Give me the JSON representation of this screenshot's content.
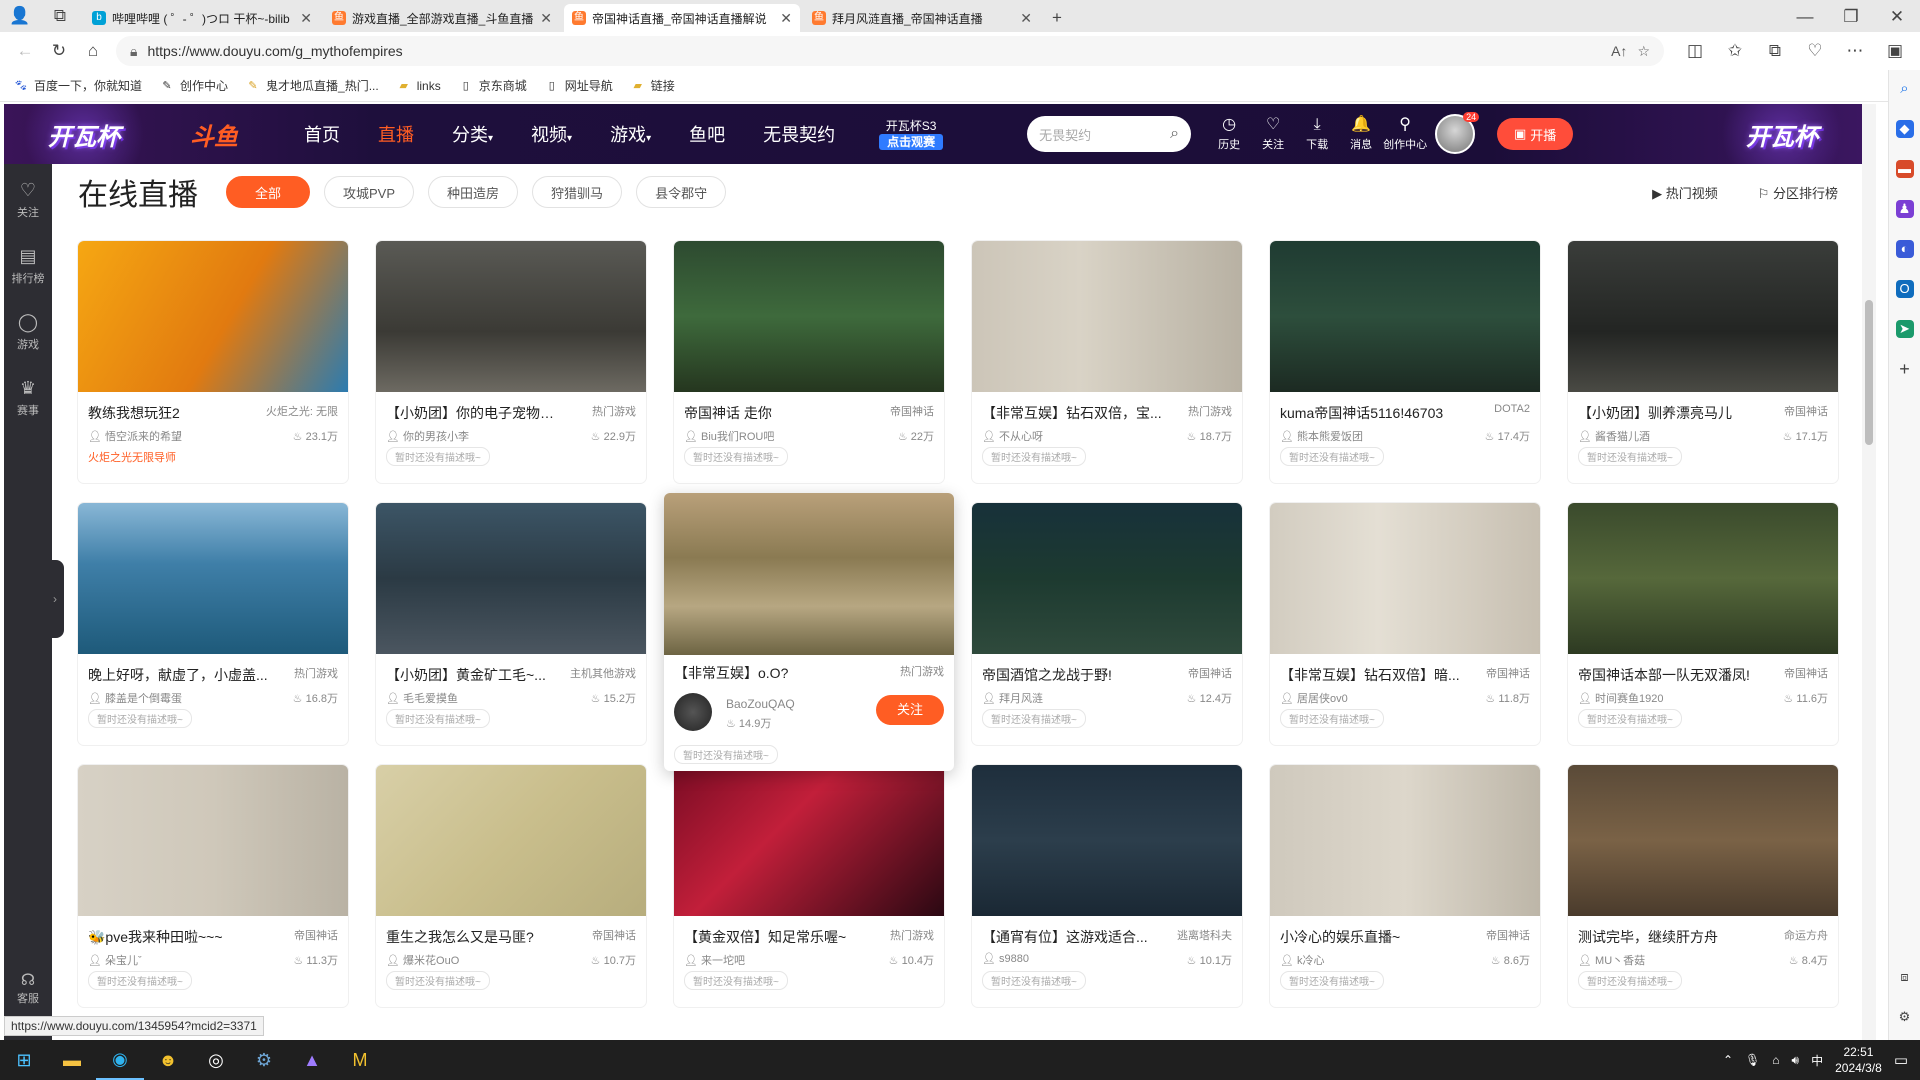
{
  "browser": {
    "tabs": [
      {
        "label": "哔哩哔哩 ( ゜- ゜)つロ 干杯~-bilib",
        "fav_color": "#00a1d6",
        "fav": "b"
      },
      {
        "label": "游戏直播_全部游戏直播_斗鱼直播",
        "fav_color": "#ff7a2f",
        "fav": "鱼"
      },
      {
        "label": "帝国神话直播_帝国神话直播解说",
        "fav_color": "#ff7a2f",
        "fav": "鱼"
      },
      {
        "label": "拜月风涟直播_帝国神话直播",
        "fav_color": "#ff7a2f",
        "fav": "鱼"
      }
    ],
    "url": "https://www.douyu.com/g_mythofempires",
    "bookmarks": [
      "百度一下，你就知道",
      "创作中心",
      "鬼才地瓜直播_热门...",
      "links",
      "京东商城",
      "网址导航",
      "链接"
    ],
    "status_url": "https://www.douyu.com/1345954?mcid2=3371"
  },
  "header": {
    "banner_text": "开瓦杯",
    "logo": "斗鱼",
    "nav": [
      "首页",
      "直播",
      "分类",
      "视频",
      "游戏",
      "鱼吧",
      "无畏契约"
    ],
    "active_nav": "直播",
    "promo_line1": "开瓦杯S3",
    "promo_line2": "点击观赛",
    "search_placeholder": "无畏契约",
    "icons": [
      {
        "label": "历史",
        "glyph": "◷"
      },
      {
        "label": "关注",
        "glyph": "♡"
      },
      {
        "label": "下载",
        "glyph": "⤓"
      },
      {
        "label": "消息",
        "glyph": "🔔"
      },
      {
        "label": "创作中心",
        "glyph": "⚲"
      }
    ],
    "avatar_badge": "24",
    "live_button": "开播"
  },
  "sidebar": {
    "items": [
      {
        "label": "关注",
        "glyph": "♡"
      },
      {
        "label": "排行榜",
        "glyph": "▤"
      },
      {
        "label": "游戏",
        "glyph": "◯"
      },
      {
        "label": "赛事",
        "glyph": "♛"
      }
    ],
    "service": "客服"
  },
  "content": {
    "title": "在线直播",
    "filters": [
      "全部",
      "攻城PVP",
      "种田造房",
      "狩猎驯马",
      "县令郡守"
    ],
    "right_links": [
      "热门视频",
      "分区排行榜"
    ]
  },
  "cards": [
    {
      "title": "教练我想玩狂2",
      "cat": "火炬之光: 无限",
      "streamer": "悟空派来的希望",
      "heat": "23.1万",
      "desc": "",
      "tag": "火炬之光无限导师",
      "thumb": "torch"
    },
    {
      "title": "【小奶团】你的电子宠物小李",
      "cat": "热门游戏",
      "streamer": "你的男孩小李",
      "heat": "22.9万",
      "desc": "暂时还没有描述哦~",
      "thumb": "dark"
    },
    {
      "title": "帝国神话 走你",
      "cat": "帝国神话",
      "streamer": "Biu我们ROU吧",
      "heat": "22万",
      "desc": "暂时还没有描述哦~",
      "thumb": "green"
    },
    {
      "title": "【非常互娱】钻石双倍，宝...",
      "cat": "热门游戏",
      "streamer": "不从心呀",
      "heat": "18.7万",
      "desc": "暂时还没有描述哦~",
      "thumb": "inv"
    },
    {
      "title": "kuma帝国神话5116!46703",
      "cat": "DOTA2",
      "streamer": "熊本熊爱饭团",
      "heat": "17.4万",
      "desc": "暂时还没有描述哦~",
      "thumb": "forest"
    },
    {
      "title": "【小奶团】驯养漂亮马儿",
      "cat": "帝国神话",
      "streamer": "酱香猫儿酒",
      "heat": "17.1万",
      "desc": "暂时还没有描述哦~",
      "thumb": "dark2"
    },
    {
      "title": "晚上好呀，献虚了，小虚盖...",
      "cat": "热门游戏",
      "streamer": "膝盖是个倒霉蛋",
      "heat": "16.8万",
      "desc": "暂时还没有描述哦~",
      "thumb": "sea"
    },
    {
      "title": "【小奶团】黄金矿工毛~...",
      "cat": "主机其他游戏",
      "streamer": "毛毛爱摸鱼",
      "heat": "15.2万",
      "desc": "暂时还没有描述哦~",
      "thumb": "mine"
    },
    {
      "title": "【非常互娱】o.O?",
      "cat": "热门游戏",
      "streamer": "BaoZouQAQ",
      "heat": "14.9万",
      "desc": "暂时还没有描述哦~",
      "thumb": "field",
      "hover": true,
      "follow": "关注"
    },
    {
      "title": "帝国酒馆之龙战于野!",
      "cat": "帝国神话",
      "streamer": "拜月风涟",
      "heat": "12.4万",
      "desc": "暂时还没有描述哦~",
      "thumb": "night"
    },
    {
      "title": "【非常互娱】钻石双倍】暗...",
      "cat": "帝国神话",
      "streamer": "居居侠ov0",
      "heat": "11.8万",
      "desc": "暂时还没有描述哦~",
      "thumb": "inv2"
    },
    {
      "title": "帝国神话本部一队无双潘凤!",
      "cat": "帝国神话",
      "streamer": "时间赛鱼1920",
      "heat": "11.6万",
      "desc": "暂时还没有描述哦~",
      "thumb": "forest2"
    },
    {
      "title": "🐝pve我来种田啦~~~",
      "cat": "帝国神话",
      "streamer": "朵宝儿ˇ",
      "heat": "11.3万",
      "desc": "暂时还没有描述哦~",
      "thumb": "inv3"
    },
    {
      "title": "重生之我怎么又是马匪?",
      "cat": "帝国神话",
      "streamer": "爆米花OuO",
      "heat": "10.7万",
      "desc": "暂时还没有描述哦~",
      "thumb": "map"
    },
    {
      "title": "【黄金双倍】知足常乐喔~",
      "cat": "热门游戏",
      "streamer": "来一坨吧",
      "heat": "10.4万",
      "desc": "暂时还没有描述哦~",
      "thumb": "anime"
    },
    {
      "title": "【通宵有位】这游戏适合...",
      "cat": "逃离塔科夫",
      "streamer": "s9880",
      "heat": "10.1万",
      "desc": "暂时还没有描述哦~",
      "thumb": "night2"
    },
    {
      "title": "小冷心的娱乐直播~",
      "cat": "帝国神话",
      "streamer": "k冷心",
      "heat": "8.6万",
      "desc": "暂时还没有描述哦~",
      "thumb": "inv4"
    },
    {
      "title": "测试完毕，继续肝方舟",
      "cat": "命运方舟",
      "streamer": "MU丶香菇",
      "heat": "8.4万",
      "desc": "暂时还没有描述哦~",
      "thumb": "brown"
    }
  ],
  "taskbar": {
    "time": "22:51",
    "date": "2024/3/8",
    "ime": "中"
  }
}
